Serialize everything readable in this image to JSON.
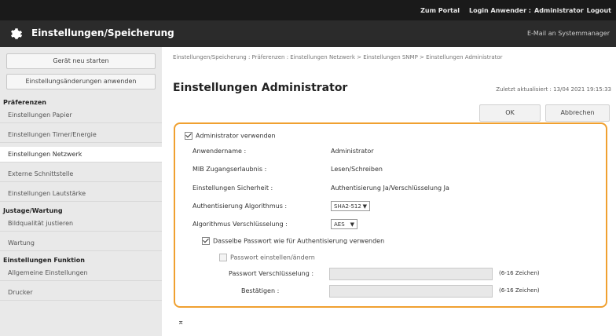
{
  "top_links": {
    "portal": "Zum Portal",
    "login_user_label": "Login Anwender :",
    "login_user_value": "Administrator",
    "logout": "Logout"
  },
  "header": {
    "title": "Einstellungen/Speicherung",
    "mail_admin": "E-Mail an Systemmanager",
    "icon": "gear-icon"
  },
  "sidebar": {
    "restart_button": "Gerät neu starten",
    "apply_button": "Einstellungsänderungen anwenden",
    "sections": [
      {
        "title": "Präferenzen",
        "items": [
          "Einstellungen Papier",
          "Einstellungen Timer/Energie",
          "Einstellungen Netzwerk",
          "Externe Schnittstelle",
          "Einstellungen Lautstärke"
        ]
      },
      {
        "title": "Justage/Wartung",
        "items": [
          "Bildqualität justieren",
          "Wartung"
        ]
      },
      {
        "title": "Einstellungen Funktion",
        "items": [
          "Allgemeine Einstellungen",
          "Drucker"
        ]
      }
    ],
    "active_item": "Einstellungen Netzwerk"
  },
  "main": {
    "breadcrumb": "Einstellungen/Speicherung : Präferenzen : Einstellungen Netzwerk > Einstellungen SNMP > Einstellungen Administrator",
    "title": "Einstellungen Administrator",
    "last_updated": "Zuletzt aktualisiert : 13/04 2021 19:15:33",
    "ok": "OK",
    "cancel": "Abbrechen",
    "form": {
      "use_admin_label": "Administrator verwenden",
      "use_admin_checked": true,
      "username_label": "Anwendername :",
      "username_value": "Administrator",
      "mib_label": "MIB Zugangserlaubnis :",
      "mib_value": "Lesen/Schreiben",
      "security_label": "Einstellungen Sicherheit :",
      "security_value": "Authentisierung Ja/Verschlüsselung Ja",
      "auth_algo_label": "Authentisierung Algorithmus :",
      "auth_algo_value": "SHA2-512",
      "enc_algo_label": "Algorithmus Verschlüsselung :",
      "enc_algo_value": "AES",
      "same_pw_label": "Dasselbe Passwort wie für Authentisierung verwenden",
      "same_pw_checked": true,
      "set_pw_label": "Passwort einstellen/ändern",
      "set_pw_checked": false,
      "enc_pw_label": "Passwort Verschlüsselung :",
      "enc_pw_hint": "(6-16 Zeichen)",
      "confirm_label": "Bestätigen :",
      "confirm_hint": "(6-16 Zeichen)"
    },
    "to_top": "⌅"
  },
  "colors": {
    "accent": "#f0a030",
    "topbar": "#1a1a1a",
    "titlebar": "#2b2b2b",
    "sidebar": "#e9e9e9"
  }
}
